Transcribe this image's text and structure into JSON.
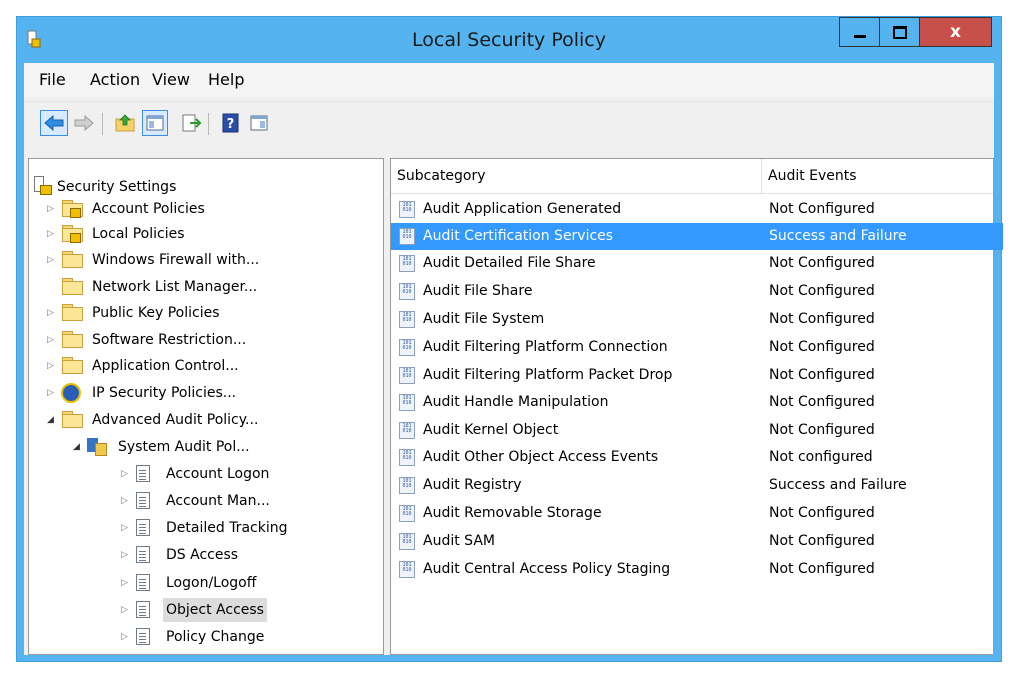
{
  "window": {
    "title": "Local Security Policy"
  },
  "menu": [
    "File",
    "Action",
    "View",
    "Help"
  ],
  "toolbar": {
    "buttons": [
      "back-icon",
      "forward-icon",
      "up-folder-icon",
      "show-hide-tree-icon",
      "export-list-icon",
      "help-icon",
      "show-action-pane-icon"
    ]
  },
  "tree": {
    "root": "Security Settings",
    "items": [
      {
        "label": "Account Policies",
        "icon": "folder-lock-icon"
      },
      {
        "label": "Local Policies",
        "icon": "folder-lock-icon"
      },
      {
        "label": "Windows Firewall with...",
        "icon": "folder-icon"
      },
      {
        "label": "Network List Manager...",
        "icon": "folder-icon"
      },
      {
        "label": "Public Key Policies",
        "icon": "folder-icon"
      },
      {
        "label": "Software Restriction...",
        "icon": "folder-icon"
      },
      {
        "label": "Application Control...",
        "icon": "folder-icon"
      },
      {
        "label": "IP Security Policies...",
        "icon": "ip-security-icon"
      },
      {
        "label": "Advanced Audit Policy...",
        "icon": "folder-icon"
      },
      {
        "label": "System Audit Pol...",
        "icon": "system-audit-icon"
      },
      {
        "label": "Account Logon",
        "icon": "policy-doc-icon"
      },
      {
        "label": "Account Man...",
        "icon": "policy-doc-icon"
      },
      {
        "label": "Detailed Tracking",
        "icon": "policy-doc-icon"
      },
      {
        "label": "DS Access",
        "icon": "policy-doc-icon"
      },
      {
        "label": "Logon/Logoff",
        "icon": "policy-doc-icon"
      },
      {
        "label": "Object Access",
        "icon": "policy-doc-icon"
      },
      {
        "label": "Policy Change",
        "icon": "policy-doc-icon"
      }
    ],
    "selected": "Object Access"
  },
  "list": {
    "columns": [
      "Subcategory",
      "Audit Events"
    ],
    "rows": [
      {
        "name": "Audit Application Generated",
        "value": "Not Configured"
      },
      {
        "name": "Audit Certification Services",
        "value": "Success and Failure"
      },
      {
        "name": "Audit Detailed File Share",
        "value": "Not Configured"
      },
      {
        "name": "Audit File Share",
        "value": "Not Configured"
      },
      {
        "name": "Audit File System",
        "value": "Not Configured"
      },
      {
        "name": "Audit Filtering Platform Connection",
        "value": "Not Configured"
      },
      {
        "name": "Audit Filtering Platform Packet Drop",
        "value": "Not Configured"
      },
      {
        "name": "Audit Handle Manipulation",
        "value": "Not Configured"
      },
      {
        "name": "Audit Kernel Object",
        "value": "Not Configured"
      },
      {
        "name": "Audit Other Object Access Events",
        "value": "Not configured"
      },
      {
        "name": "Audit Registry",
        "value": "Success and Failure"
      },
      {
        "name": "Audit Removable Storage",
        "value": "Not Configured"
      },
      {
        "name": "Audit SAM",
        "value": "Not Configured"
      },
      {
        "name": "Audit Central Access Policy Staging",
        "value": "Not Configured"
      }
    ],
    "selected_row": "Audit Certification Services"
  },
  "colors": {
    "title_bar": "#55b4f0",
    "close_button": "#c7504b",
    "selection": "#3399ff"
  }
}
